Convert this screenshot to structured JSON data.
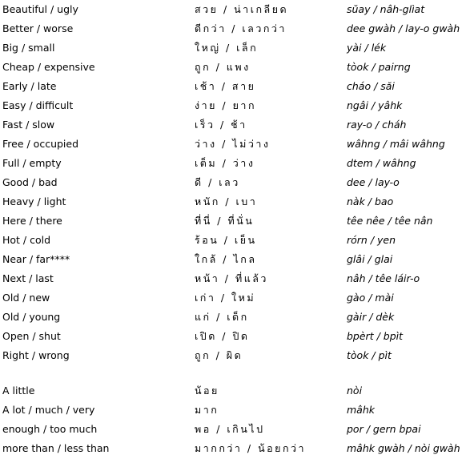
{
  "groups": [
    {
      "rows": [
        {
          "english": "Beautiful / ugly",
          "thai": "สวย / น่าเกลียด",
          "transliteration": "sŭay / nâh-glìat"
        },
        {
          "english": "Better / worse",
          "thai": "ดีกว่า / เลวกว่า",
          "transliteration": "dee gwàh / lay-o gwàh"
        },
        {
          "english": "Big / small",
          "thai": "ใหญ่ / เล็ก",
          "transliteration": "yài / lék"
        },
        {
          "english": "Cheap / expensive",
          "thai": "ถูก / แพง",
          "transliteration": "tòok / pairng"
        },
        {
          "english": "Early / late",
          "thai": "เช้า / สาย",
          "transliteration": "cháo / săi"
        },
        {
          "english": "Easy / difficult",
          "thai": "ง่าย / ยาก",
          "transliteration": "ngâi / yâhk"
        },
        {
          "english": "Fast / slow",
          "thai": "เร็ว / ช้า",
          "transliteration": "ray-o / cháh"
        },
        {
          "english": "Free / occupied",
          "thai": "ว่าง / ไม่ว่าง",
          "transliteration": "wâhng / mâi wâhng"
        },
        {
          "english": "Full / empty",
          "thai": "เต็ม / ว่าง",
          "transliteration": "dtem / wâhng"
        },
        {
          "english": "Good / bad",
          "thai": "ดี / เลว",
          "transliteration": "dee / lay-o"
        },
        {
          "english": "Heavy / light",
          "thai": "หนัก / เบา",
          "transliteration": "nàk / bao"
        },
        {
          "english": "Here / there",
          "thai": "ที่นี่ / ที่นั่น",
          "transliteration": "têe nêe / têe nân"
        },
        {
          "english": "Hot / cold",
          "thai": "ร้อน / เย็น",
          "transliteration": "rórn / yen"
        },
        {
          "english": "Near / far****",
          "thai": "ใกล้ / ไกล",
          "transliteration": "glâi / glai"
        },
        {
          "english": "Next / last",
          "thai": "หน้า / ที่แล้ว",
          "transliteration": "nâh / têe láir-o"
        },
        {
          "english": "Old / new",
          "thai": "เก่า / ใหม่",
          "transliteration": "gào / mài"
        },
        {
          "english": "Old / young",
          "thai": "แก่ / เด็ก",
          "transliteration": "gàir / dèk"
        },
        {
          "english": "Open / shut",
          "thai": "เปิด / ปิด",
          "transliteration": "bpèrt / bpìt"
        },
        {
          "english": "Right / wrong",
          "thai": "ถูก / ผิด",
          "transliteration": "tòok / pìt"
        }
      ]
    },
    {
      "rows": [
        {
          "english": "A little",
          "thai": "น้อย",
          "transliteration": "nòi"
        },
        {
          "english": "A lot / much / very",
          "thai": "มาก",
          "transliteration": "mâhk"
        },
        {
          "english": "enough / too much",
          "thai": "พอ / เกินไป",
          "transliteration": "por / gern bpai"
        },
        {
          "english": "more than / less than",
          "thai": "มากกว่า / น้อยกว่า",
          "transliteration": "mâhk gwàh / nòi gwàh"
        }
      ]
    }
  ]
}
